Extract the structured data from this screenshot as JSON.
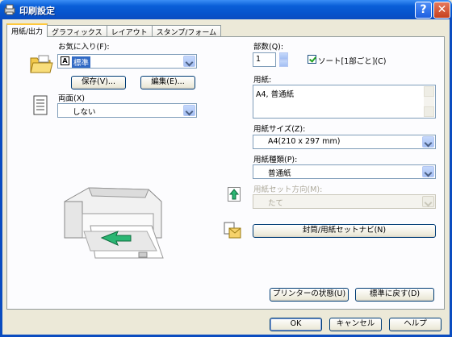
{
  "window": {
    "title": "印刷設定",
    "help_label": "?",
    "close_label": "✕"
  },
  "tabs": [
    "用紙/出力",
    "グラフィックス",
    "レイアウト",
    "スタンプ/フォーム"
  ],
  "left": {
    "favorites_label": "お気に入り(F):",
    "favorites_value": "標準",
    "favorites_badge": "A",
    "save_button": "保存(V)...",
    "edit_button": "編集(E)...",
    "duplex_label": "両面(X)",
    "duplex_value": "しない"
  },
  "right": {
    "copies_label": "部数(Q):",
    "copies_value": "1",
    "collate_label": "ソート[1部ごと](C)",
    "paper_label": "用紙:",
    "paper_value": "A4, 普通紙",
    "paper_size_label": "用紙サイズ(Z):",
    "paper_size_value": "A4(210 x 297 mm)",
    "paper_type_label": "用紙種類(P):",
    "paper_type_value": "普通紙",
    "feed_direction_label": "用紙セット方向(M):",
    "feed_direction_value": "たて",
    "navi_button": "封筒/用紙セットナビ(N)",
    "printer_status_button": "プリンターの状態(U)",
    "reset_button": "標準に戻す(D)"
  },
  "footer": {
    "ok": "OK",
    "cancel": "キャンセル",
    "help": "ヘルプ"
  },
  "colors": {
    "title_bar": "#0a5fd8",
    "selection": "#316ac5",
    "tab_highlight": "#ffc83c"
  }
}
